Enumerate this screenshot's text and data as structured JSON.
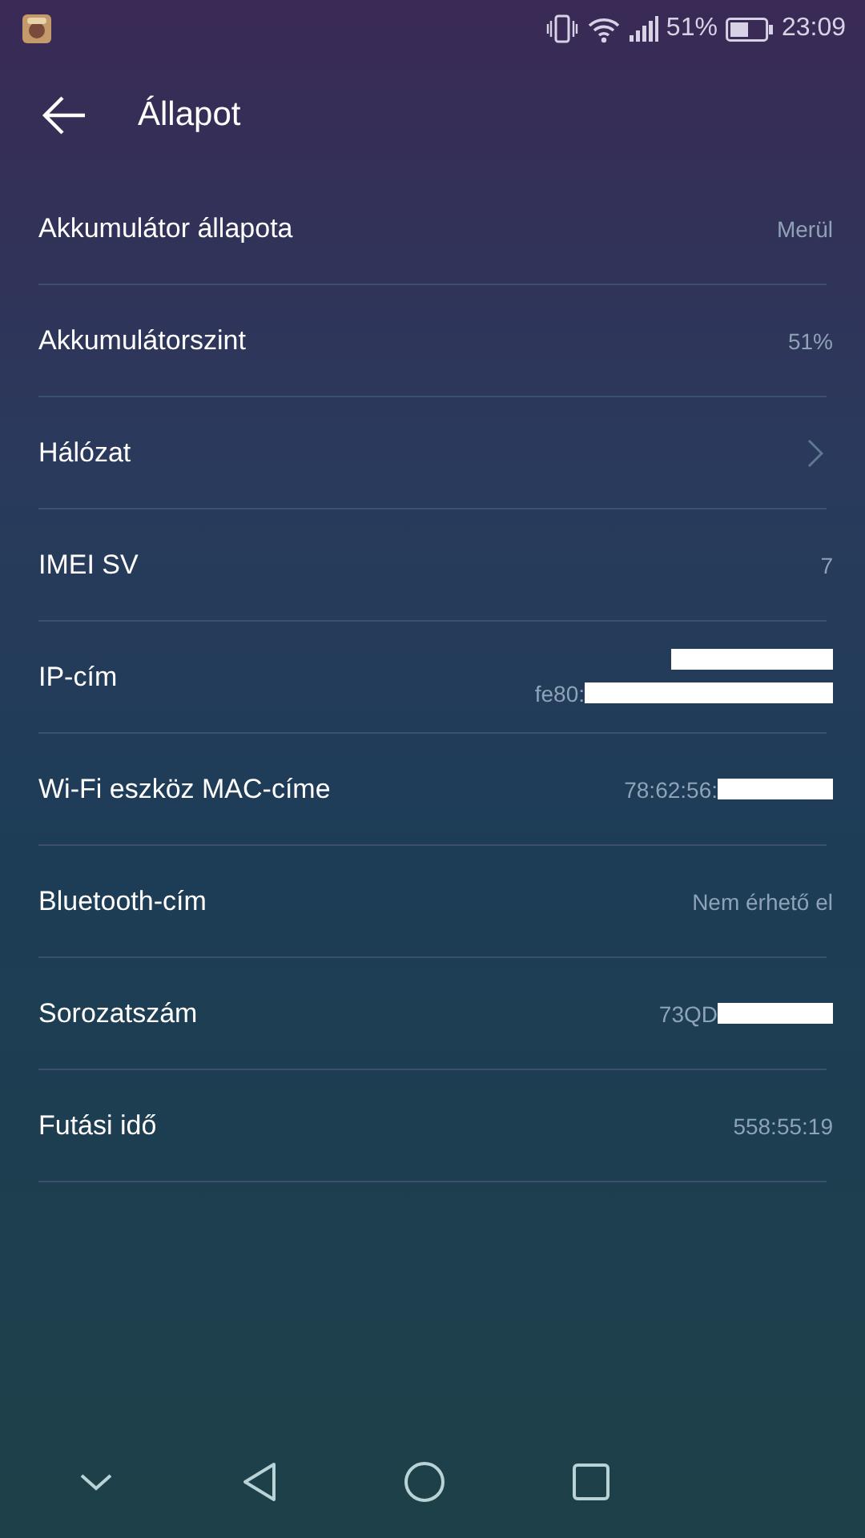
{
  "status_bar": {
    "battery_text": "51%",
    "time": "23:09"
  },
  "header": {
    "title": "Állapot"
  },
  "rows": [
    {
      "kind": "value",
      "label": "Akkumulátor állapota",
      "lines": [
        {
          "text": "Merül",
          "redacted": false
        }
      ]
    },
    {
      "kind": "value",
      "label": "Akkumulátorszint",
      "lines": [
        {
          "text": "51%",
          "redacted": false
        }
      ]
    },
    {
      "kind": "link",
      "label": "Hálózat"
    },
    {
      "kind": "value",
      "label": "IMEI SV",
      "lines": [
        {
          "text": "7",
          "redacted": false
        }
      ]
    },
    {
      "kind": "value",
      "label": "IP-cím",
      "lines": [
        {
          "redacted": true
        },
        {
          "text": "fe80:",
          "redacted": true
        }
      ]
    },
    {
      "kind": "value",
      "label": "Wi-Fi eszköz MAC-címe",
      "lines": [
        {
          "text": "78:62:56:",
          "redacted": true
        }
      ]
    },
    {
      "kind": "value",
      "label": "Bluetooth-cím",
      "lines": [
        {
          "text": "Nem érhető el",
          "redacted": false
        }
      ]
    },
    {
      "kind": "value",
      "label": "Sorozatszám",
      "lines": [
        {
          "text": "73QD",
          "redacted": true
        }
      ]
    },
    {
      "kind": "value",
      "label": "Futási idő",
      "lines": [
        {
          "text": "558:55:19",
          "redacted": false
        }
      ]
    }
  ]
}
